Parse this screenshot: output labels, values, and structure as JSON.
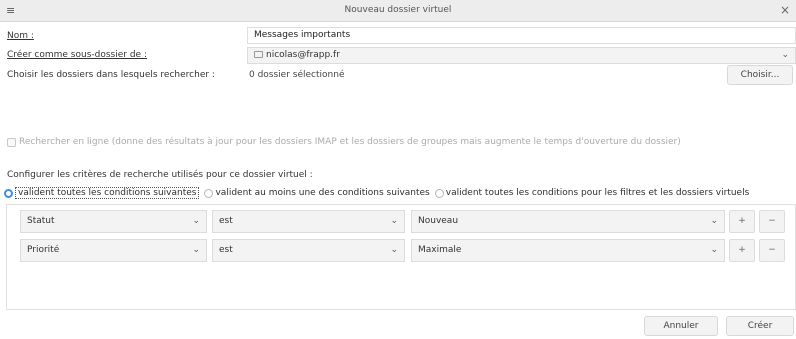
{
  "window": {
    "title": "Nouveau dossier virtuel",
    "menu_glyph": "≡",
    "close_glyph": "×"
  },
  "form": {
    "name_label": "Nom :",
    "name_value": "Messages importants",
    "parent_label": "Créer comme sous-dossier de :",
    "parent_value": "nicolas@frapp.fr",
    "folders_label": "Choisir les dossiers dans lesquels rechercher :",
    "folders_value": "0 dossier sélectionné",
    "choose_button": "Choisir...",
    "online_search_label": "Rechercher en ligne (donne des résultats à jour pour les dossiers IMAP et les dossiers de groupes mais augmente le temps d'ouverture du dossier)",
    "online_search_checked": false,
    "criteria_label": "Configurer les critères de recherche utilisés pour ce dossier virtuel :"
  },
  "match_options": [
    {
      "label": "valident toutes les conditions suivantes",
      "selected": true
    },
    {
      "label": "valident au moins une des conditions suivantes",
      "selected": false
    },
    {
      "label": "valident toutes les conditions pour les filtres et les dossiers virtuels",
      "selected": false
    }
  ],
  "conditions": [
    {
      "field": "Statut",
      "operator": "est",
      "value": "Nouveau"
    },
    {
      "field": "Priorité",
      "operator": "est",
      "value": "Maximale"
    }
  ],
  "row_buttons": {
    "add": "+",
    "remove": "−"
  },
  "icons": {
    "chevron": "⌄",
    "account": "account-icon"
  },
  "footer": {
    "cancel": "Annuler",
    "create": "Créer"
  },
  "colors": {
    "accent": "#3e8ede"
  }
}
